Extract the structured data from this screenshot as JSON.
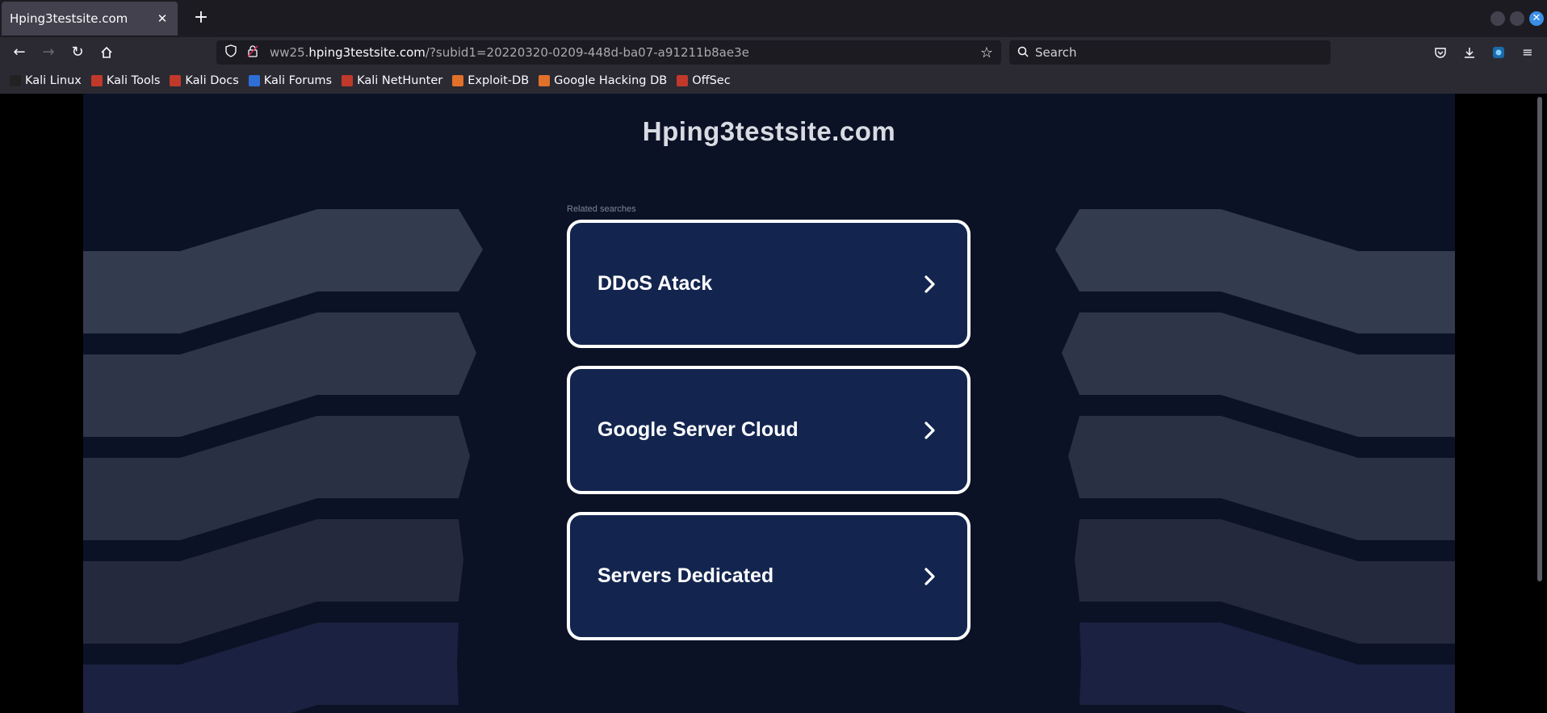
{
  "browser": {
    "tab_title": "Hping3testsite.com",
    "tab_close": "✕",
    "new_tab": "+",
    "url_prefix": "ww25.",
    "url_host": "hping3testsite.com",
    "url_path": "/?subid1=20220320-0209-448d-ba07-a91211b8ae3e",
    "search_placeholder": "Search",
    "icons": [
      "back-icon",
      "forward-icon",
      "reload-icon",
      "home-icon",
      "shield-icon",
      "lock-icon",
      "star-icon",
      "search-icon",
      "pocket-icon",
      "download-icon",
      "extension-icon",
      "menu-icon"
    ]
  },
  "bookmarks": [
    {
      "label": "Kali Linux",
      "color": "#222222"
    },
    {
      "label": "Kali Tools",
      "color": "#c0392b"
    },
    {
      "label": "Kali Docs",
      "color": "#c0392b"
    },
    {
      "label": "Kali Forums",
      "color": "#2e6fd6"
    },
    {
      "label": "Kali NetHunter",
      "color": "#c0392b"
    },
    {
      "label": "Exploit-DB",
      "color": "#e0702a"
    },
    {
      "label": "Google Hacking DB",
      "color": "#e0702a"
    },
    {
      "label": "OffSec",
      "color": "#c0392b"
    }
  ],
  "page": {
    "site_title": "Hping3testsite.com",
    "related_label": "Related searches",
    "links": [
      {
        "label": "DDoS Atack"
      },
      {
        "label": "Google Server Cloud"
      },
      {
        "label": "Servers Dedicated"
      }
    ],
    "colors": {
      "background": "#0b1226",
      "card": "#13254f",
      "card_border": "#ffffff"
    }
  }
}
